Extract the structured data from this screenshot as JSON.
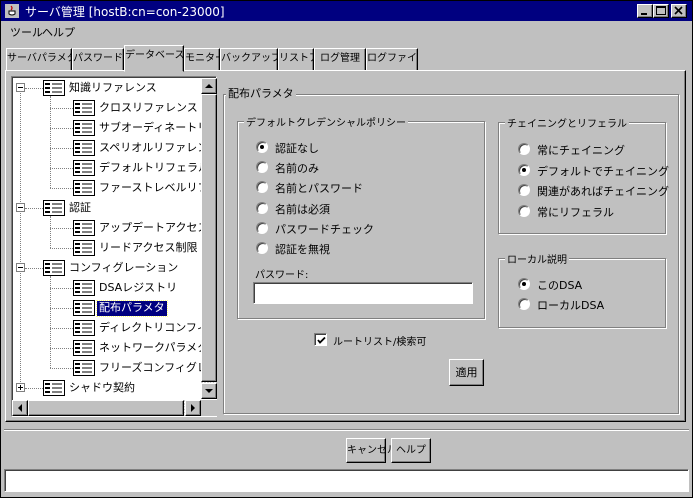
{
  "window": {
    "title": "サーバ管理 [hostB:cn=con-23000]",
    "controls": {
      "minimize": "minimize-icon",
      "maximize": "maximize-icon",
      "close": "close-icon"
    }
  },
  "menubar": {
    "items": [
      "ツール",
      "ヘルプ"
    ]
  },
  "tabs": {
    "items": [
      "サーバパラメタ",
      "パスワード",
      "データベース",
      "モニター",
      "バックアップ",
      "リストア",
      "ログ管理",
      "ログファイル"
    ],
    "active_index": 2
  },
  "tree": {
    "nodes": [
      {
        "label": "知識リファレンス",
        "level": 0,
        "expander": "minus"
      },
      {
        "label": "クロスリファレンス",
        "level": 1
      },
      {
        "label": "サブオーディネートリファレンス",
        "level": 1
      },
      {
        "label": "スペリオルリファレンス",
        "level": 1
      },
      {
        "label": "デフォルトリフェラル",
        "level": 1
      },
      {
        "label": "ファーストレベルリファレンス",
        "level": 1
      },
      {
        "label": "認証",
        "level": 0,
        "expander": "minus"
      },
      {
        "label": "アップデートアクセス制限",
        "level": 1
      },
      {
        "label": "リードアクセス制限",
        "level": 1
      },
      {
        "label": "コンフィグレーション",
        "level": 0,
        "expander": "minus"
      },
      {
        "label": "DSAレジストリ",
        "level": 1
      },
      {
        "label": "配布パラメタ",
        "level": 1,
        "selected": true
      },
      {
        "label": "ディレクトリコンフィグレーション",
        "level": 1
      },
      {
        "label": "ネットワークパラメタ",
        "level": 1
      },
      {
        "label": "フリーズコンフィグレーション",
        "level": 1
      },
      {
        "label": "シャドウ契約",
        "level": 0,
        "expander": "plus"
      }
    ],
    "node_icon": "directory-node-icon"
  },
  "panel": {
    "title": "配布パラメタ",
    "default_credential_policy": {
      "title": "デフォルトクレデンシャルポリシー",
      "options": [
        "認証なし",
        "名前のみ",
        "名前とパスワード",
        "名前は必須",
        "パスワードチェック",
        "認証を無視"
      ],
      "selected_index": 0,
      "password_label": "パスワード:",
      "password_value": ""
    },
    "chaining_and_referral": {
      "title": "チェイニングとリフェラル",
      "options": [
        "常にチェイニング",
        "デフォルトでチェイニング",
        "関連があればチェイニング",
        "常にリフェラル"
      ],
      "selected_index": 1
    },
    "local_description": {
      "title": "ローカル説明",
      "options": [
        "このDSA",
        "ローカルDSA"
      ],
      "selected_index": 0
    },
    "root_list_checkbox": {
      "label": "ルートリスト/検索可",
      "checked": true
    },
    "apply_button": "適用"
  },
  "footer": {
    "cancel_button": "キャンセル",
    "help_button": "ヘルプ",
    "status_text": ""
  }
}
